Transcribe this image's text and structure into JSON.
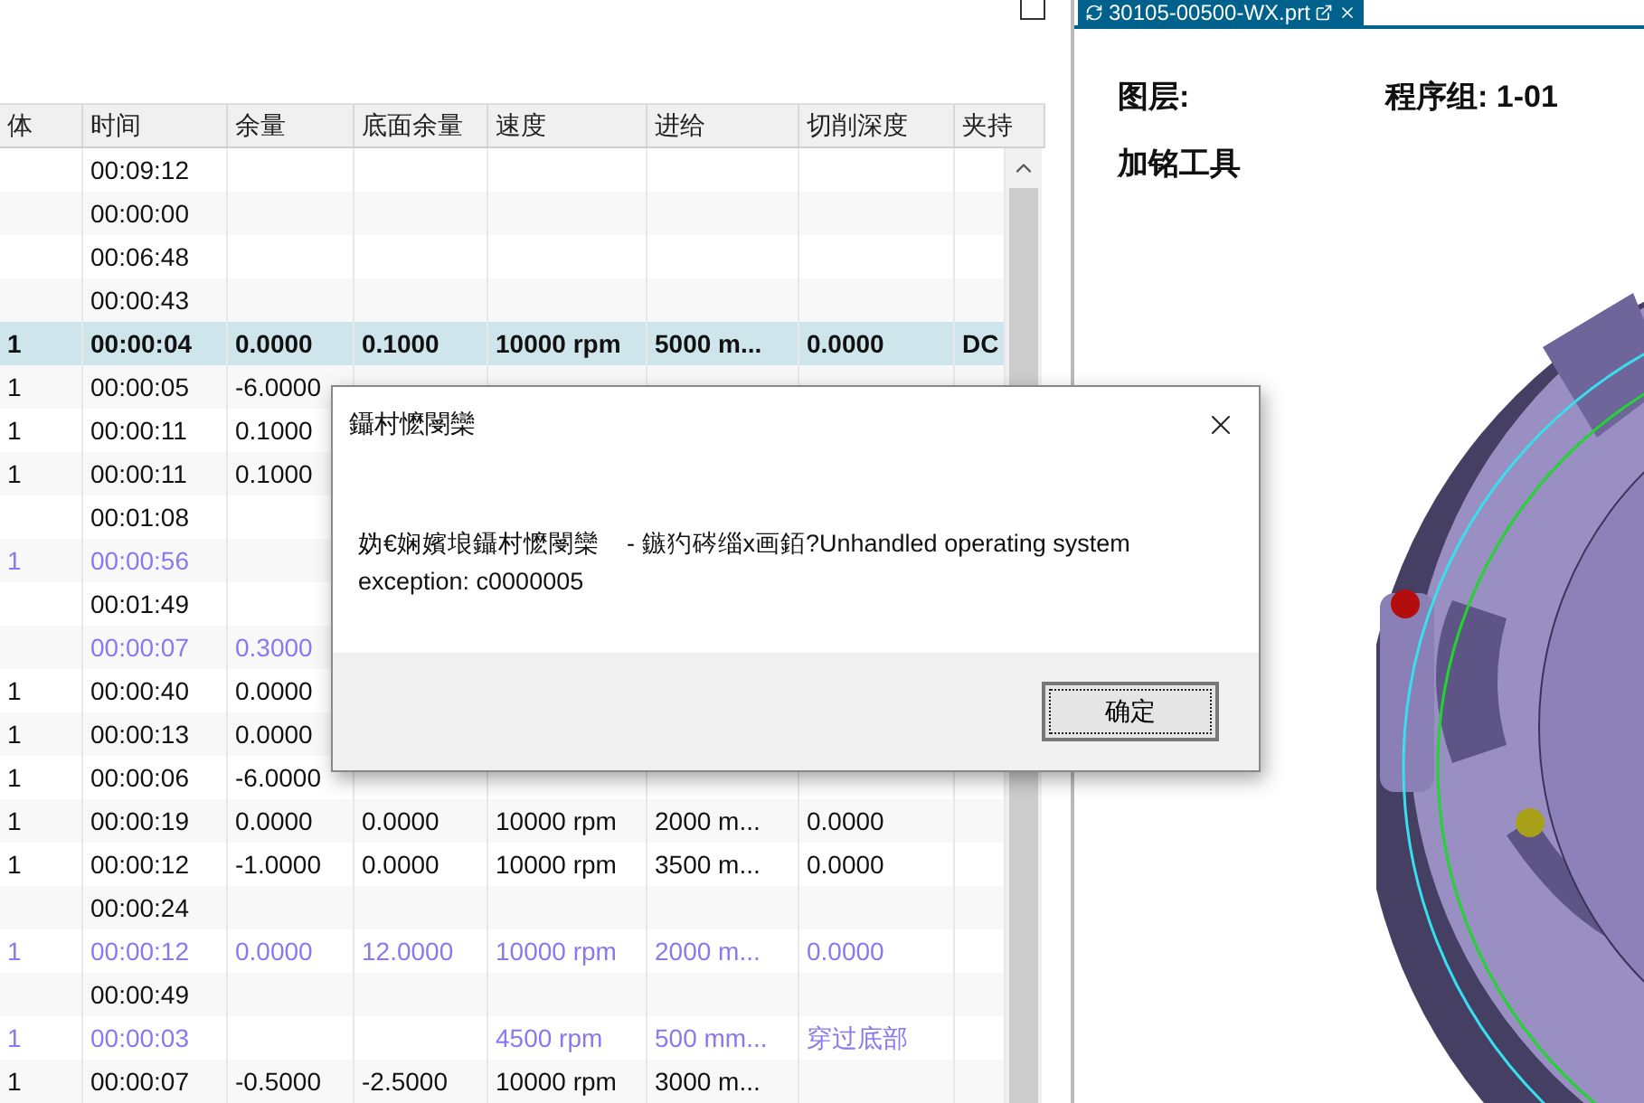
{
  "operation_table": {
    "columns": [
      "体",
      "时间",
      "余量",
      "底面余量",
      "速度",
      "进给",
      "切削深度",
      "夹持"
    ],
    "rows": [
      {
        "selected": false,
        "kind": "normal",
        "time": "00:09:12"
      },
      {
        "selected": false,
        "kind": "normal",
        "time": "00:00:00"
      },
      {
        "selected": false,
        "kind": "normal",
        "time": "00:06:48"
      },
      {
        "selected": false,
        "kind": "normal",
        "time": "00:00:43"
      },
      {
        "selected": true,
        "kind": "normal",
        "column_1": "1",
        "time": "00:00:04",
        "allowance": "0.0000",
        "floor_allowance": "0.1000",
        "speed": "10000 rpm",
        "feed": "5000 m...",
        "cut_depth": "0.0000",
        "holder": "DC"
      },
      {
        "selected": false,
        "kind": "normal",
        "column_1": "1",
        "time": "00:00:05",
        "allowance": "-6.0000"
      },
      {
        "selected": false,
        "kind": "normal",
        "column_1": "1",
        "time": "00:00:11",
        "allowance": "0.1000"
      },
      {
        "selected": false,
        "kind": "normal",
        "column_1": "1",
        "time": "00:00:11",
        "allowance": "0.1000"
      },
      {
        "selected": false,
        "kind": "normal",
        "time": "00:01:08"
      },
      {
        "selected": false,
        "kind": "dimmed",
        "column_1": "1",
        "time": "00:00:56"
      },
      {
        "selected": false,
        "kind": "normal",
        "time": "00:01:49"
      },
      {
        "selected": false,
        "kind": "dimmed",
        "time": "00:00:07",
        "allowance": "0.3000"
      },
      {
        "selected": false,
        "kind": "normal",
        "column_1": "1",
        "time": "00:00:40",
        "allowance": "0.0000"
      },
      {
        "selected": false,
        "kind": "normal",
        "column_1": "1",
        "time": "00:00:13",
        "allowance": "0.0000"
      },
      {
        "selected": false,
        "kind": "normal",
        "column_1": "1",
        "time": "00:00:06",
        "allowance": "-6.0000"
      },
      {
        "selected": false,
        "kind": "normal",
        "column_1": "1",
        "time": "00:00:19",
        "allowance": "0.0000",
        "floor_allowance": "0.0000",
        "speed": "10000 rpm",
        "feed": "2000 m...",
        "cut_depth": "0.0000"
      },
      {
        "selected": false,
        "kind": "normal",
        "column_1": "1",
        "time": "00:00:12",
        "allowance": "-1.0000",
        "floor_allowance": "0.0000",
        "speed": "10000 rpm",
        "feed": "3500 m...",
        "cut_depth": "0.0000"
      },
      {
        "selected": false,
        "kind": "normal",
        "time": "00:00:24"
      },
      {
        "selected": false,
        "kind": "dimmed",
        "column_1": "1",
        "time": "00:00:12",
        "allowance": "0.0000",
        "floor_allowance": "12.0000",
        "speed": "10000 rpm",
        "feed": "2000 m...",
        "cut_depth": "0.0000"
      },
      {
        "selected": false,
        "kind": "normal",
        "time": "00:00:49"
      },
      {
        "selected": false,
        "kind": "dimmed",
        "column_1": "1",
        "time": "00:00:03",
        "speed": "4500 rpm",
        "feed": "500 mm...",
        "cut_depth": "穿过底部"
      },
      {
        "selected": false,
        "kind": "normal",
        "column_1": "1",
        "time": "00:00:07",
        "allowance": "-0.5000",
        "floor_allowance": "-2.5000",
        "speed": "10000 rpm",
        "feed": "3000 m..."
      }
    ]
  },
  "viewport": {
    "tab": {
      "label": "30105-00500-WX.prt"
    },
    "layer_label": "图层:",
    "group_label": "程序组: 1-01",
    "tool_label": "加铭工具"
  },
  "dialog": {
    "title": "鑷村懡閿欒",
    "message": "妫€娴嬪埌鑷村懡閿欒    - 鏃犳硶缁х画銆?Unhandled operating system exception: c0000005",
    "buttons": [
      "确定"
    ]
  }
}
